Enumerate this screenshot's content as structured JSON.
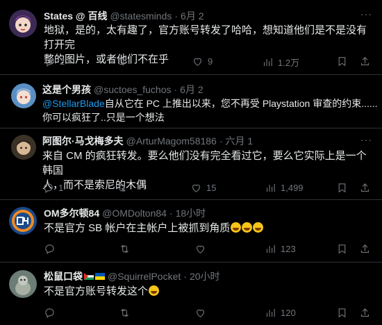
{
  "tweets": [
    {
      "name": "States @ 百线",
      "handle": "@statesminds",
      "time": "6月 2",
      "text_lines": [
        "地狱，是的，太有趣了，官方账号转发了哈哈，想知道他们是不是没有打开完",
        "整的图片，或者他们不在乎"
      ],
      "replies": "2",
      "reposts": "",
      "likes": "9",
      "views": "1.2万"
    },
    {
      "name": "这是个男孩",
      "handle": "@suctoes_fuchos",
      "time": "6月 2",
      "mention": "@StellarBlade",
      "text_line1_rest": "自从它在 PC 上推出以来，您不再受 Playstation 审查的约束......",
      "text_line2": "你可以疯狂了..只是一个想法"
    },
    {
      "name": "阿图尔·马戈梅多夫",
      "handle": "@ArturMagom58186",
      "time": "六月 1",
      "text_lines": [
        "来自 CM 的疯狂转发。要么他们没有完全看过它，要么它实际上是一个韩国",
        "人，而不是索尼的木偶"
      ],
      "replies": "1",
      "reposts": "",
      "likes": "15",
      "views": "1,499"
    },
    {
      "name": "OM多尔顿84",
      "handle": "@OMDolton84",
      "time": "18小时",
      "text": "不是官方 SB 帐户在主帐户上被抓到角质",
      "replies": "",
      "reposts": "",
      "likes": "",
      "views": "123"
    },
    {
      "name": "松鼠口袋",
      "handle": "@SquirrelPocket",
      "time": "20小时",
      "text": "不是官方账号转发这个",
      "replies": "",
      "reposts": "",
      "likes": "",
      "views": "120"
    }
  ],
  "more_label": "···",
  "dot": "·",
  "colors": {
    "background": "#000000",
    "text": "#e7e9ea",
    "muted": "#71767b",
    "link": "#1d9bf0",
    "divider": "#2f3336"
  },
  "icons": [
    "reply-icon",
    "repost-icon",
    "like-icon",
    "views-icon",
    "bookmark-icon",
    "share-icon",
    "more-icon",
    "laughing-emoji",
    "crying-emoji"
  ]
}
